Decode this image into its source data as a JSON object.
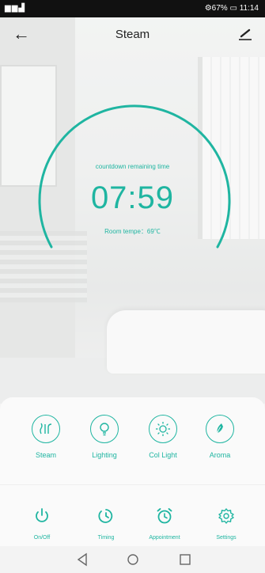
{
  "status_bar": {
    "left_icons": "▆▆▟",
    "right_text": "⚙67% ▭ 11:14"
  },
  "header": {
    "title": "Steam",
    "back_icon": "arrow-left-icon",
    "edit_icon": "pen-icon"
  },
  "timer": {
    "label": "countdown remaining time",
    "time": "07:59",
    "room_temp": "Room tempe：69℃",
    "accent": "#1fb5a1"
  },
  "functions": [
    {
      "label": "Steam",
      "icon": "steam-icon"
    },
    {
      "label": "Lighting",
      "icon": "bulb-icon"
    },
    {
      "label": "Col Light",
      "icon": "sun-icon"
    },
    {
      "label": "Aroma",
      "icon": "leaf-icon"
    }
  ],
  "bottom_nav": [
    {
      "label": "On/Off",
      "icon": "power-icon"
    },
    {
      "label": "Timing",
      "icon": "timer-icon"
    },
    {
      "label": "Appointment",
      "icon": "alarm-clock-icon"
    },
    {
      "label": "Settings",
      "icon": "gear-icon"
    }
  ],
  "system_nav": [
    "back-triangle-icon",
    "home-circle-icon",
    "recents-square-icon"
  ]
}
